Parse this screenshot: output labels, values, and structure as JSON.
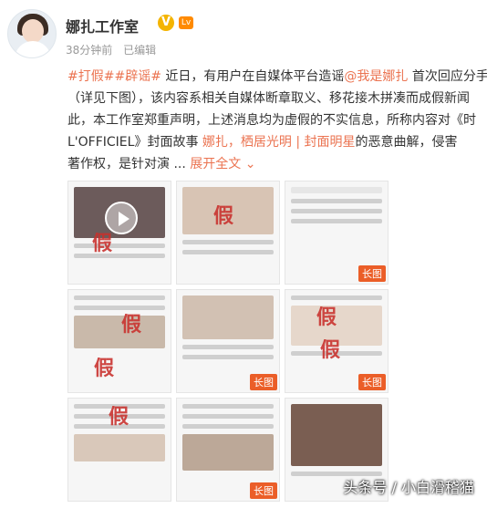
{
  "post": {
    "author": "娜扎工作室",
    "verified_badge": "V",
    "level_badge": "Lv",
    "time": "38分钟前",
    "edited": "已编辑",
    "tag1": "#打假##辟谣#",
    "line1_a": " 近日，有用户在自媒体平台造谣",
    "mention": "@我是娜扎",
    "line1_b": " 首次回应分手",
    "line2": "（详见下图），该内容系相关自媒体断章取义、移花接木拼凑而成假新闻",
    "line3": "此，本工作室郑重声明，上述消息均为虚假的不实信息，所称内容对《时",
    "line4_a": "L'OFFICIEL》封面故事 ",
    "link_text": "娜扎，栖居光明 | 封面明星",
    "line4_b": "的恶意曲解，侵害",
    "line5_a": "著作权，是针对演 ...",
    "expand": "展开全文",
    "expand_icon": "chevron-down-icon"
  },
  "grid": {
    "fake_label": "假",
    "long_label": "长图",
    "watermark": "头条号 / 小白滑稽猫"
  },
  "colors": {
    "accent": "#eb7350",
    "fake": "#c9302c",
    "badge": "#f4b400"
  }
}
